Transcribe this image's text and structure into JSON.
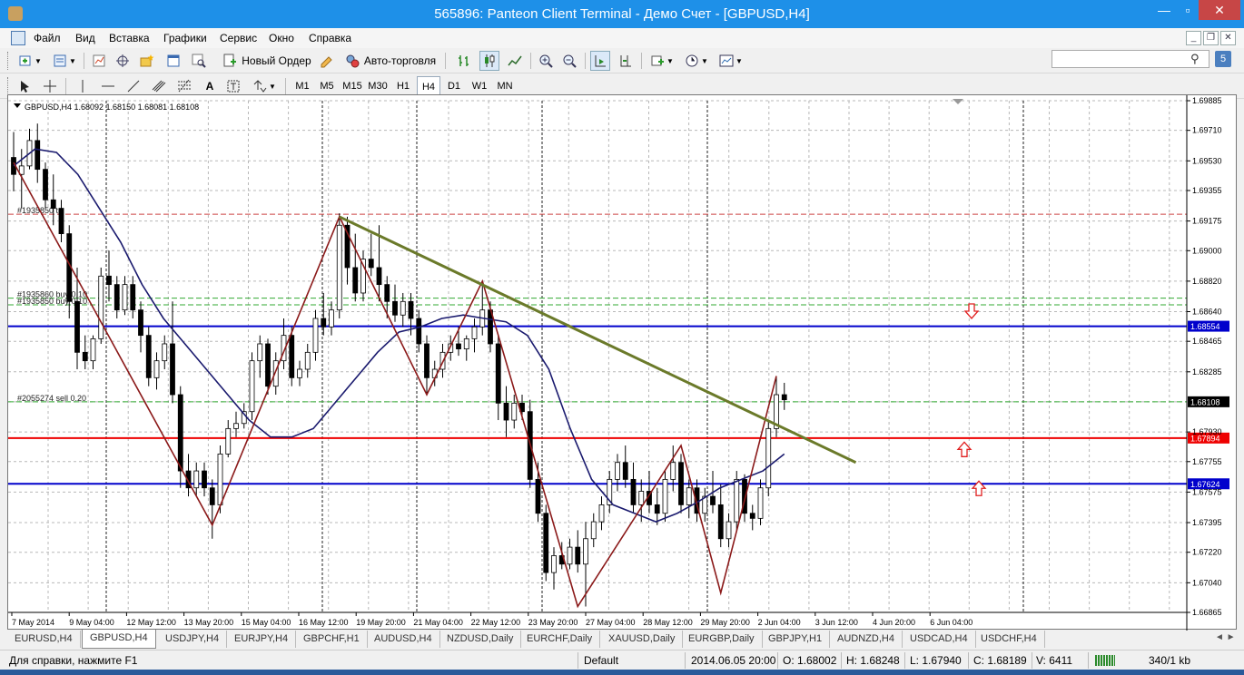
{
  "window": {
    "title": "565896: Panteon Client Terminal - Демо Счет - [GBPUSD,H4]"
  },
  "menu": [
    "Файл",
    "Вид",
    "Вставка",
    "Графики",
    "Сервис",
    "Окно",
    "Справка"
  ],
  "toolbar": {
    "new_order": "Новый Ордер",
    "auto_trading": "Авто-торговля"
  },
  "draw_tools": {
    "text_tool": "A"
  },
  "timeframes": [
    "M1",
    "M5",
    "M15",
    "M30",
    "H1",
    "H4",
    "D1",
    "W1",
    "MN"
  ],
  "active_timeframe": "H4",
  "search": {
    "value": ""
  },
  "messages_badge": "5",
  "chart": {
    "header": "GBPUSD,H4  1.68092 1.68150 1.68081 1.68108",
    "price_labels": [
      "1.69885",
      "1.69710",
      "1.69530",
      "1.69355",
      "1.69175",
      "1.69000",
      "1.68820",
      "1.68640",
      "1.68465",
      "1.68285",
      "1.68108",
      "1.67930",
      "1.67755",
      "1.67575",
      "1.67395",
      "1.67220",
      "1.67040",
      "1.66865"
    ],
    "current_price": "1.68108",
    "hlines": [
      {
        "price": 1.68554,
        "label": "1.68554",
        "color": "#0000cc",
        "style": "solid"
      },
      {
        "price": 1.67894,
        "label": "1.67894",
        "color": "#ee0000",
        "style": "solid"
      },
      {
        "price": 1.67624,
        "label": "1.67624",
        "color": "#0000cc",
        "style": "solid"
      }
    ],
    "orders": [
      {
        "price": 1.69215,
        "text": "#1935850 tp",
        "color": "#cc4444"
      },
      {
        "price": 1.6872,
        "text": "#1935860 buy 0.10",
        "color": "#33aa33"
      },
      {
        "price": 1.6868,
        "text": "#1935850 buy 0.10",
        "color": "#33aa33"
      },
      {
        "price": 1.68108,
        "text": "#2055274 sell 0.20",
        "color": "#33aa33"
      }
    ],
    "date_labels": [
      "7 May 2014",
      "9 May 04:00",
      "12 May 12:00",
      "13 May 20:00",
      "15 May 04:00",
      "16 May 12:00",
      "19 May 20:00",
      "21 May 04:00",
      "22 May 12:00",
      "23 May 20:00",
      "27 May 04:00",
      "28 May 12:00",
      "29 May 20:00",
      "2 Jun 04:00",
      "3 Jun 12:00",
      "4 Jun 20:00",
      "6 Jun 04:00"
    ]
  },
  "chart_data": {
    "type": "candlestick",
    "symbol": "GBPUSD",
    "timeframe": "H4",
    "ylim": [
      1.66865,
      1.69885
    ],
    "candles": [
      [
        1.6955,
        1.697,
        1.6935,
        1.6945
      ],
      [
        1.6945,
        1.696,
        1.6925,
        1.695
      ],
      [
        1.695,
        1.6972,
        1.6948,
        1.6965
      ],
      [
        1.6965,
        1.6975,
        1.694,
        1.6948
      ],
      [
        1.6948,
        1.6952,
        1.6925,
        1.693
      ],
      [
        1.693,
        1.6945,
        1.6915,
        1.6925
      ],
      [
        1.6925,
        1.693,
        1.6905,
        1.691
      ],
      [
        1.691,
        1.6915,
        1.686,
        1.687
      ],
      [
        1.687,
        1.689,
        1.683,
        1.684
      ],
      [
        1.684,
        1.685,
        1.683,
        1.6835
      ],
      [
        1.6835,
        1.685,
        1.683,
        1.6848
      ],
      [
        1.6848,
        1.689,
        1.6845,
        1.6885
      ],
      [
        1.6885,
        1.69,
        1.687,
        1.688
      ],
      [
        1.688,
        1.6885,
        1.686,
        1.6865
      ],
      [
        1.6865,
        1.6885,
        1.6862,
        1.688
      ],
      [
        1.688,
        1.6885,
        1.686,
        1.6865
      ],
      [
        1.6865,
        1.687,
        1.684,
        1.685
      ],
      [
        1.685,
        1.6855,
        1.682,
        1.6825
      ],
      [
        1.6825,
        1.684,
        1.6818,
        1.6835
      ],
      [
        1.6835,
        1.685,
        1.683,
        1.6845
      ],
      [
        1.6845,
        1.687,
        1.681,
        1.6815
      ],
      [
        1.6815,
        1.682,
        1.676,
        1.677
      ],
      [
        1.677,
        1.678,
        1.6755,
        1.676
      ],
      [
        1.676,
        1.6775,
        1.6755,
        1.677
      ],
      [
        1.677,
        1.6775,
        1.6755,
        1.676
      ],
      [
        1.676,
        1.6765,
        1.673,
        1.675
      ],
      [
        1.675,
        1.6785,
        1.6745,
        1.678
      ],
      [
        1.678,
        1.68,
        1.6778,
        1.6795
      ],
      [
        1.6795,
        1.6805,
        1.679,
        1.6798
      ],
      [
        1.6798,
        1.681,
        1.6795,
        1.6805
      ],
      [
        1.6805,
        1.684,
        1.68,
        1.6835
      ],
      [
        1.6835,
        1.685,
        1.6825,
        1.6845
      ],
      [
        1.6845,
        1.6848,
        1.6815,
        1.682
      ],
      [
        1.682,
        1.684,
        1.6815,
        1.6835
      ],
      [
        1.6835,
        1.686,
        1.683,
        1.685
      ],
      [
        1.685,
        1.6855,
        1.682,
        1.6825
      ],
      [
        1.6825,
        1.6835,
        1.682,
        1.683
      ],
      [
        1.683,
        1.6845,
        1.6825,
        1.684
      ],
      [
        1.684,
        1.6865,
        1.6835,
        1.686
      ],
      [
        1.686,
        1.6875,
        1.685,
        1.6855
      ],
      [
        1.6855,
        1.687,
        1.685,
        1.6865
      ],
      [
        1.6865,
        1.6922,
        1.686,
        1.6915
      ],
      [
        1.6915,
        1.692,
        1.688,
        1.689
      ],
      [
        1.689,
        1.691,
        1.687,
        1.6875
      ],
      [
        1.6875,
        1.69,
        1.687,
        1.6895
      ],
      [
        1.6895,
        1.691,
        1.6885,
        1.689
      ],
      [
        1.689,
        1.6915,
        1.687,
        1.688
      ],
      [
        1.688,
        1.6885,
        1.686,
        1.687
      ],
      [
        1.687,
        1.688,
        1.6858,
        1.6862
      ],
      [
        1.6862,
        1.6875,
        1.6855,
        1.687
      ],
      [
        1.687,
        1.6875,
        1.685,
        1.686
      ],
      [
        1.686,
        1.6865,
        1.684,
        1.6845
      ],
      [
        1.6845,
        1.685,
        1.6815,
        1.6825
      ],
      [
        1.6825,
        1.6835,
        1.682,
        1.683
      ],
      [
        1.683,
        1.6845,
        1.6825,
        1.684
      ],
      [
        1.684,
        1.685,
        1.6835,
        1.6845
      ],
      [
        1.6845,
        1.6855,
        1.6838,
        1.6842
      ],
      [
        1.6842,
        1.685,
        1.6835,
        1.6848
      ],
      [
        1.6848,
        1.686,
        1.684,
        1.6855
      ],
      [
        1.6855,
        1.6882,
        1.685,
        1.6865
      ],
      [
        1.6865,
        1.687,
        1.684,
        1.6845
      ],
      [
        1.6845,
        1.685,
        1.68,
        1.681
      ],
      [
        1.681,
        1.682,
        1.679,
        1.68
      ],
      [
        1.68,
        1.6815,
        1.6795,
        1.681
      ],
      [
        1.681,
        1.6815,
        1.68,
        1.6805
      ],
      [
        1.6805,
        1.6812,
        1.676,
        1.6765
      ],
      [
        1.6765,
        1.6775,
        1.674,
        1.6745
      ],
      [
        1.6745,
        1.675,
        1.6705,
        1.671
      ],
      [
        1.671,
        1.6725,
        1.67,
        1.672
      ],
      [
        1.672,
        1.6728,
        1.6712,
        1.6715
      ],
      [
        1.6715,
        1.673,
        1.6712,
        1.6725
      ],
      [
        1.6725,
        1.6735,
        1.671,
        1.6715
      ],
      [
        1.6715,
        1.674,
        1.669,
        1.673
      ],
      [
        1.673,
        1.6745,
        1.6725,
        1.674
      ],
      [
        1.674,
        1.6755,
        1.6735,
        1.675
      ],
      [
        1.675,
        1.677,
        1.6745,
        1.6765
      ],
      [
        1.6765,
        1.678,
        1.6758,
        1.6775
      ],
      [
        1.6775,
        1.6785,
        1.676,
        1.6765
      ],
      [
        1.6765,
        1.6775,
        1.6745,
        1.675
      ],
      [
        1.675,
        1.6765,
        1.674,
        1.6758
      ],
      [
        1.6758,
        1.677,
        1.6745,
        1.675
      ],
      [
        1.675,
        1.676,
        1.6738,
        1.6745
      ],
      [
        1.6745,
        1.677,
        1.674,
        1.6765
      ],
      [
        1.6765,
        1.6785,
        1.6758,
        1.6775
      ],
      [
        1.6775,
        1.678,
        1.6745,
        1.675
      ],
      [
        1.675,
        1.6765,
        1.6742,
        1.676
      ],
      [
        1.676,
        1.6765,
        1.674,
        1.6745
      ],
      [
        1.6745,
        1.676,
        1.674,
        1.6755
      ],
      [
        1.6755,
        1.677,
        1.6745,
        1.675
      ],
      [
        1.675,
        1.6762,
        1.6725,
        1.673
      ],
      [
        1.673,
        1.6745,
        1.6725,
        1.674
      ],
      [
        1.674,
        1.677,
        1.6735,
        1.6765
      ],
      [
        1.6765,
        1.6768,
        1.674,
        1.6745
      ],
      [
        1.6745,
        1.675,
        1.6735,
        1.6742
      ],
      [
        1.6742,
        1.6765,
        1.6738,
        1.676
      ],
      [
        1.676,
        1.68,
        1.6755,
        1.6795
      ],
      [
        1.6795,
        1.6826,
        1.679,
        1.6815
      ],
      [
        1.6815,
        1.6822,
        1.6806,
        1.6812
      ]
    ],
    "ma": [
      1.695,
      1.696,
      1.6958,
      1.6945,
      1.6925,
      1.6905,
      1.688,
      1.686,
      1.6845,
      1.683,
      1.6815,
      1.68,
      1.679,
      1.679,
      1.6795,
      1.681,
      1.6825,
      1.684,
      1.6852,
      1.6855,
      1.686,
      1.6862,
      1.686,
      1.6858,
      1.685,
      1.683,
      1.6795,
      1.6765,
      1.675,
      1.6745,
      1.674,
      1.6745,
      1.6752,
      1.676,
      1.6765,
      1.677,
      1.678
    ],
    "zigzag": [
      [
        1.6952,
        0
      ],
      [
        1.6738,
        25
      ],
      [
        1.692,
        41
      ],
      [
        1.6815,
        52
      ],
      [
        1.6882,
        59
      ],
      [
        1.669,
        71
      ],
      [
        1.6785,
        84
      ],
      [
        1.6698,
        89
      ],
      [
        1.6826,
        96
      ]
    ],
    "trendline": [
      [
        1.692,
        41
      ],
      [
        1.6775,
        106
      ]
    ]
  },
  "tabs": [
    "EURUSD,H4",
    "GBPUSD,H4",
    "USDJPY,H4",
    "EURJPY,H4",
    "GBPCHF,H1",
    "AUDUSD,H4",
    "NZDUSD,Daily",
    "EURCHF,Daily",
    "XAUUSD,Daily",
    "EURGBP,Daily",
    "GBPJPY,H1",
    "AUDNZD,H4",
    "USDCAD,H4",
    "USDCHF,H4"
  ],
  "active_tab": "GBPUSD,H4",
  "status": {
    "help": "Для справки, нажмите F1",
    "profile": "Default",
    "datetime": "2014.06.05 20:00",
    "open": "O: 1.68002",
    "high": "H: 1.68248",
    "low": "L: 1.67940",
    "close": "C: 1.68189",
    "volume": "V: 6411",
    "traffic": "340/1 kb"
  }
}
